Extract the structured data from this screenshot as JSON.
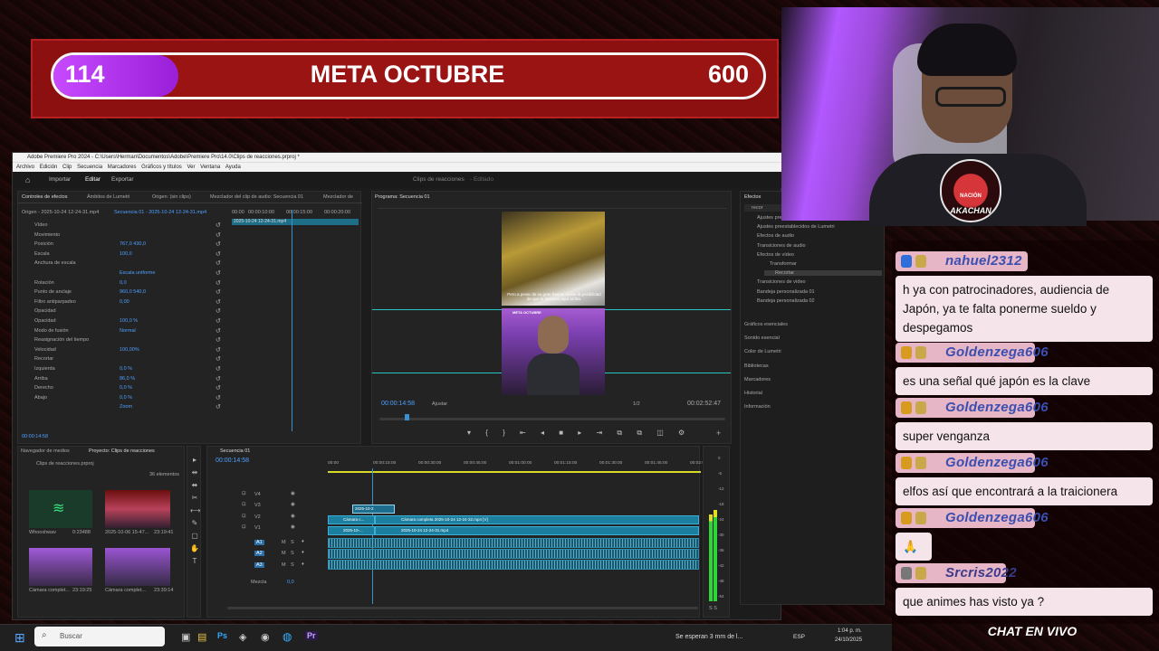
{
  "goal": {
    "current": "114",
    "title": "META OCTUBRE",
    "target": "600",
    "progress_fraction": 0.19
  },
  "premiere": {
    "title": "Adobe Premiere Pro 2024 - C:\\Users\\Herman\\Documentos\\Adobe\\Premiere Pro\\14.0\\Clips de reacciones.prproj *",
    "menu": [
      "Archivo",
      "Edición",
      "Clip",
      "Secuencia",
      "Marcadores",
      "Gráficos y títulos",
      "Ver",
      "Ventana",
      "Ayuda"
    ],
    "workspace_tabs": [
      "Importar",
      "Editar",
      "Exportar"
    ],
    "project_name": "Clips de reacciones",
    "project_status": "- Editado",
    "fx_tabs": [
      "Controles de efectos",
      "Ámbitos de Lumetri",
      "Origen: (sin clips)",
      "Mezclador del clip de audio: Secuencia 01",
      "Mezclador de"
    ],
    "fx_source": "Origen - 2025-10-24 12-24-31.mp4",
    "fx_seq": "Secuencia 01 - 2025-10-24 12-24-31.mp4",
    "fx_times": [
      "00:00",
      "00:00:10:00",
      "00:00:15:00",
      "00:00:20:00"
    ],
    "fx_clip_label": "2025-10-24 12-24-31.mp4",
    "fx_rows": [
      {
        "label": "Vídeo",
        "value": ""
      },
      {
        "label": "Movimiento",
        "value": ""
      },
      {
        "label": "Posición",
        "value": "767,0     430,0"
      },
      {
        "label": "Escala",
        "value": "100,0"
      },
      {
        "label": "Anchura de escala",
        "value": ""
      },
      {
        "label": "",
        "value": "Escala uniforme"
      },
      {
        "label": "Rotación",
        "value": "0,0"
      },
      {
        "label": "Punto de anclaje",
        "value": "960,0     540,0"
      },
      {
        "label": "Filtro antiparpadeo",
        "value": "0,00"
      },
      {
        "label": "Opacidad",
        "value": ""
      },
      {
        "label": "Opacidad",
        "value": "100,0 %"
      },
      {
        "label": "Modo de fusión",
        "value": "Normal"
      },
      {
        "label": "Reasignación del tiempo",
        "value": ""
      },
      {
        "label": "Velocidad",
        "value": "100,00%"
      },
      {
        "label": "Recortar",
        "value": ""
      },
      {
        "label": "Izquierda",
        "value": "0,0 %"
      },
      {
        "label": "Arriba",
        "value": "86,0 %"
      },
      {
        "label": "Derecho",
        "value": "0,0 %"
      },
      {
        "label": "Abajo",
        "value": "0,0 %"
      },
      {
        "label": "",
        "value": "Zoom"
      }
    ],
    "fx_timecode": "00:00:14:58",
    "program_title": "Programa: Secuencia 01",
    "program_timecode": "00:00:14:58",
    "program_fit": "Ajustar",
    "program_quality": "1/2",
    "program_duration": "00:02:52:47",
    "cam_overlay": "META OCTUBRE",
    "subtitle": "Pero a pesar de su gran fuerza, existe la posibilidad de que le lastimes aquí arriba.",
    "effects_title": "Efectos",
    "effects_search": "recor",
    "effects_tree": [
      "Ajustes pre",
      "Ajustes preestablecidos de Lumetri",
      "Efectos de audio",
      "Transiciones de audio",
      "Efectos de vídeo",
      "Transformar",
      "Recortar",
      "Transiciones de vídeo",
      "Bandeja personalizada 01",
      "Bandeja personalizada 02"
    ],
    "effects_sections": [
      "Gráficos esenciales",
      "Sonido esencial",
      "Color de Lumetri",
      "Bibliotecas",
      "Marcadores",
      "Historial",
      "Información"
    ],
    "project_tabs": [
      "Navegador de medios",
      "Proyecto: Clips de reacciones"
    ],
    "project_file": "Clips de reacciones.prproj",
    "project_count": "36 elementos",
    "project_items": [
      {
        "name": "Whooshwav",
        "dur": "0:23488"
      },
      {
        "name": "2025-10-06 15-47...",
        "dur": "23:19:41"
      },
      {
        "name": "Cámara complet...",
        "dur": "23:19:25"
      },
      {
        "name": "Cámara complet...",
        "dur": "23:39:14"
      }
    ],
    "sequence_tab": "Secuencia 01",
    "timeline_timecode": "00:00:14:58",
    "ruler": [
      "00:00",
      "00:00:15:00",
      "00:00:30:00",
      "00:00:45:00",
      "00:01:00:00",
      "00:01:15:00",
      "00:01:30:00",
      "00:01:45:00",
      "00:02:00:00"
    ],
    "tracks_video": [
      "V4",
      "V3",
      "V2",
      "V1"
    ],
    "tracks_audio": [
      "A1",
      "A2",
      "A3"
    ],
    "mix_label": "Mezcla",
    "mix_value": "0,0",
    "clip_v3": "2025-10-2",
    "clip_v2a": "Cámara c...",
    "clip_v2b": "Cámara completa 2025-10-24 12-24-32.mp4 [V]",
    "clip_v1a": "2025-10-...",
    "clip_v1b": "2025-10-24 12-24-31.mp4",
    "meter_labels": [
      "0",
      "-6",
      "-12",
      "-18",
      "-24",
      "-30",
      "-36",
      "-42",
      "-48",
      "-54"
    ],
    "meter_footer": "S S"
  },
  "webcam": {
    "logo_text": "AKACHAN",
    "logo_top": "NACIÓN"
  },
  "chat": {
    "messages": [
      {
        "user": "nahuel2312",
        "text": "h ya con patrocinadores, audiencia de Japón, ya te falta ponerme sueldo y despegamos"
      },
      {
        "user": "Goldenzega606",
        "text": "es una señal qué japón es la clave"
      },
      {
        "user": "Goldenzega606",
        "text": "super venganza"
      },
      {
        "user": "Goldenzega606",
        "text": "elfos así que encontrará a la traicionera"
      },
      {
        "user": "Goldenzega606",
        "text": "🙏"
      },
      {
        "user": "Srcris2022",
        "text": "que animes has visto ya ?"
      }
    ],
    "title": "CHAT EN VIVO"
  },
  "taskbar": {
    "search_placeholder": "Buscar",
    "weather": "Se esperan 3 mm de l...",
    "lang": "ESP",
    "time": "1:04 p. m.",
    "date": "24/10/2025"
  }
}
